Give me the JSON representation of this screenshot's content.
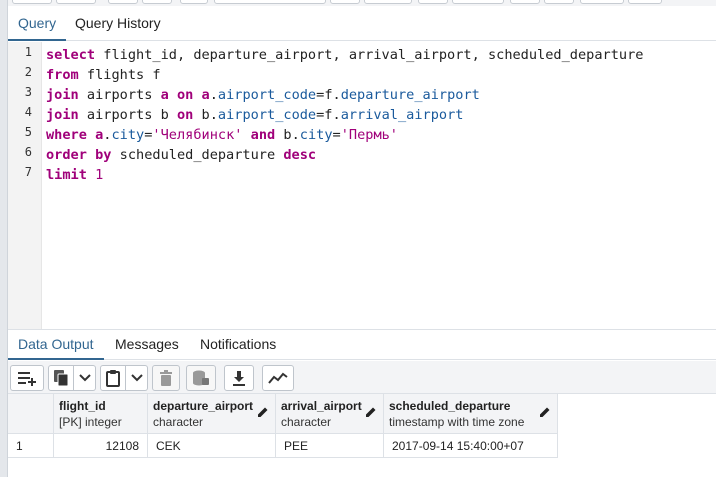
{
  "query_tabs": [
    {
      "label": "Query",
      "active": true
    },
    {
      "label": "Query History",
      "active": false
    }
  ],
  "editor": {
    "line_numbers": [
      "1",
      "2",
      "3",
      "4",
      "5",
      "6",
      "7"
    ],
    "lines": [
      [
        {
          "t": "select",
          "c": "kw"
        },
        {
          "t": " flight_id, departure_airport, arrival_airport, scheduled_departure",
          "c": "op"
        }
      ],
      [
        {
          "t": "from",
          "c": "kw"
        },
        {
          "t": " flights f",
          "c": "op"
        }
      ],
      [
        {
          "t": "join",
          "c": "kw"
        },
        {
          "t": " airports ",
          "c": "op"
        },
        {
          "t": "a",
          "c": "kw"
        },
        {
          "t": " ",
          "c": "op"
        },
        {
          "t": "on",
          "c": "kw"
        },
        {
          "t": " ",
          "c": "op"
        },
        {
          "t": "a",
          "c": "kw"
        },
        {
          "t": ".",
          "c": "op"
        },
        {
          "t": "airport_code",
          "c": "fn"
        },
        {
          "t": "=",
          "c": "op"
        },
        {
          "t": "f",
          "c": "op"
        },
        {
          "t": ".",
          "c": "op"
        },
        {
          "t": "departure_airport",
          "c": "fn"
        }
      ],
      [
        {
          "t": "join",
          "c": "kw"
        },
        {
          "t": " airports b ",
          "c": "op"
        },
        {
          "t": "on",
          "c": "kw"
        },
        {
          "t": " b.",
          "c": "op"
        },
        {
          "t": "airport_code",
          "c": "fn"
        },
        {
          "t": "=f.",
          "c": "op"
        },
        {
          "t": "arrival_airport",
          "c": "fn"
        }
      ],
      [
        {
          "t": "where",
          "c": "kw"
        },
        {
          "t": " ",
          "c": "op"
        },
        {
          "t": "a",
          "c": "kw"
        },
        {
          "t": ".",
          "c": "op"
        },
        {
          "t": "city",
          "c": "fn"
        },
        {
          "t": "=",
          "c": "op"
        },
        {
          "t": "'Челябинск'",
          "c": "str"
        },
        {
          "t": " ",
          "c": "op"
        },
        {
          "t": "and",
          "c": "kw"
        },
        {
          "t": " b.",
          "c": "op"
        },
        {
          "t": "city",
          "c": "fn"
        },
        {
          "t": "=",
          "c": "op"
        },
        {
          "t": "'Пермь'",
          "c": "str"
        }
      ],
      [
        {
          "t": "order by",
          "c": "kw"
        },
        {
          "t": " scheduled_departure ",
          "c": "op"
        },
        {
          "t": "desc",
          "c": "kw"
        }
      ],
      [
        {
          "t": "limit",
          "c": "kw"
        },
        {
          "t": " ",
          "c": "op"
        },
        {
          "t": "1",
          "c": "num"
        }
      ]
    ]
  },
  "output_tabs": [
    {
      "label": "Data Output",
      "active": true
    },
    {
      "label": "Messages",
      "active": false
    },
    {
      "label": "Notifications",
      "active": false
    }
  ],
  "output_toolbar": {
    "icons": [
      "add-row-icon",
      "copy-icon",
      "copy-dropdown-icon",
      "paste-icon",
      "paste-dropdown-icon",
      "delete-icon",
      "save-data-icon",
      "download-icon",
      "graph-visualiser-icon"
    ]
  },
  "grid": {
    "columns": [
      {
        "name": "flight_id",
        "type": "[PK] integer"
      },
      {
        "name": "departure_airport",
        "type": "character"
      },
      {
        "name": "arrival_airport",
        "type": "character"
      },
      {
        "name": "scheduled_departure",
        "type": "timestamp with time zone"
      }
    ],
    "rows": [
      {
        "num": "1",
        "cells": [
          "12108",
          "CEK",
          "PEE",
          "2017-09-14 15:40:00+07"
        ]
      }
    ]
  }
}
